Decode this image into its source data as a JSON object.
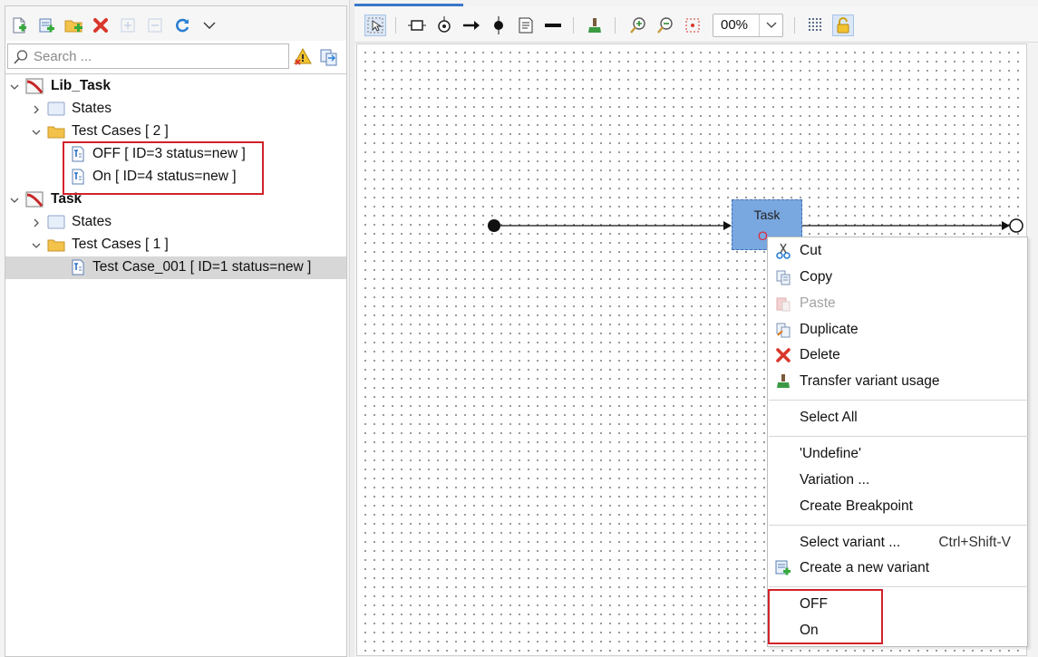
{
  "left_panel": {
    "search": {
      "placeholder": "Search ..."
    },
    "tree": [
      {
        "label": "Lib_Task"
      },
      {
        "label": "States"
      },
      {
        "label": "Test Cases  [ 2 ]"
      },
      {
        "label": "OFF  [ ID=3 status=new ]"
      },
      {
        "label": "On  [ ID=4 status=new ]"
      },
      {
        "label": "Task"
      },
      {
        "label": "States"
      },
      {
        "label": "Test Cases  [ 1 ]"
      },
      {
        "label": "Test Case_001  [ ID=1 status=new ]"
      }
    ]
  },
  "right_panel": {
    "zoom": {
      "value": "00%"
    }
  },
  "diagram": {
    "state": {
      "title": "Task",
      "subtitle": "O"
    }
  },
  "context_menu": {
    "items": [
      {
        "label": "Cut",
        "icon": "scissors-icon"
      },
      {
        "label": "Copy",
        "icon": "copy-icon"
      },
      {
        "label": "Paste",
        "icon": "paste-icon",
        "disabled": true
      },
      {
        "label": "Duplicate",
        "icon": "duplicate-icon"
      },
      {
        "label": "Delete",
        "icon": "delete-icon"
      },
      {
        "label": "Transfer variant usage",
        "icon": "transfer-icon"
      },
      {
        "label": "Select All"
      },
      {
        "label": "'Undefine'"
      },
      {
        "label": "Variation ..."
      },
      {
        "label": "Create Breakpoint"
      },
      {
        "label": "Select variant ...",
        "shortcut": "Ctrl+Shift-V"
      },
      {
        "label": "Create a new variant",
        "icon": "new-variant-icon"
      },
      {
        "label": "OFF"
      },
      {
        "label": "On"
      }
    ]
  },
  "colors": {
    "highlight_box": "#d2222a",
    "state_fill": "#79a7df",
    "selection": "#d7d7d7",
    "accent": "#3a77c9"
  }
}
